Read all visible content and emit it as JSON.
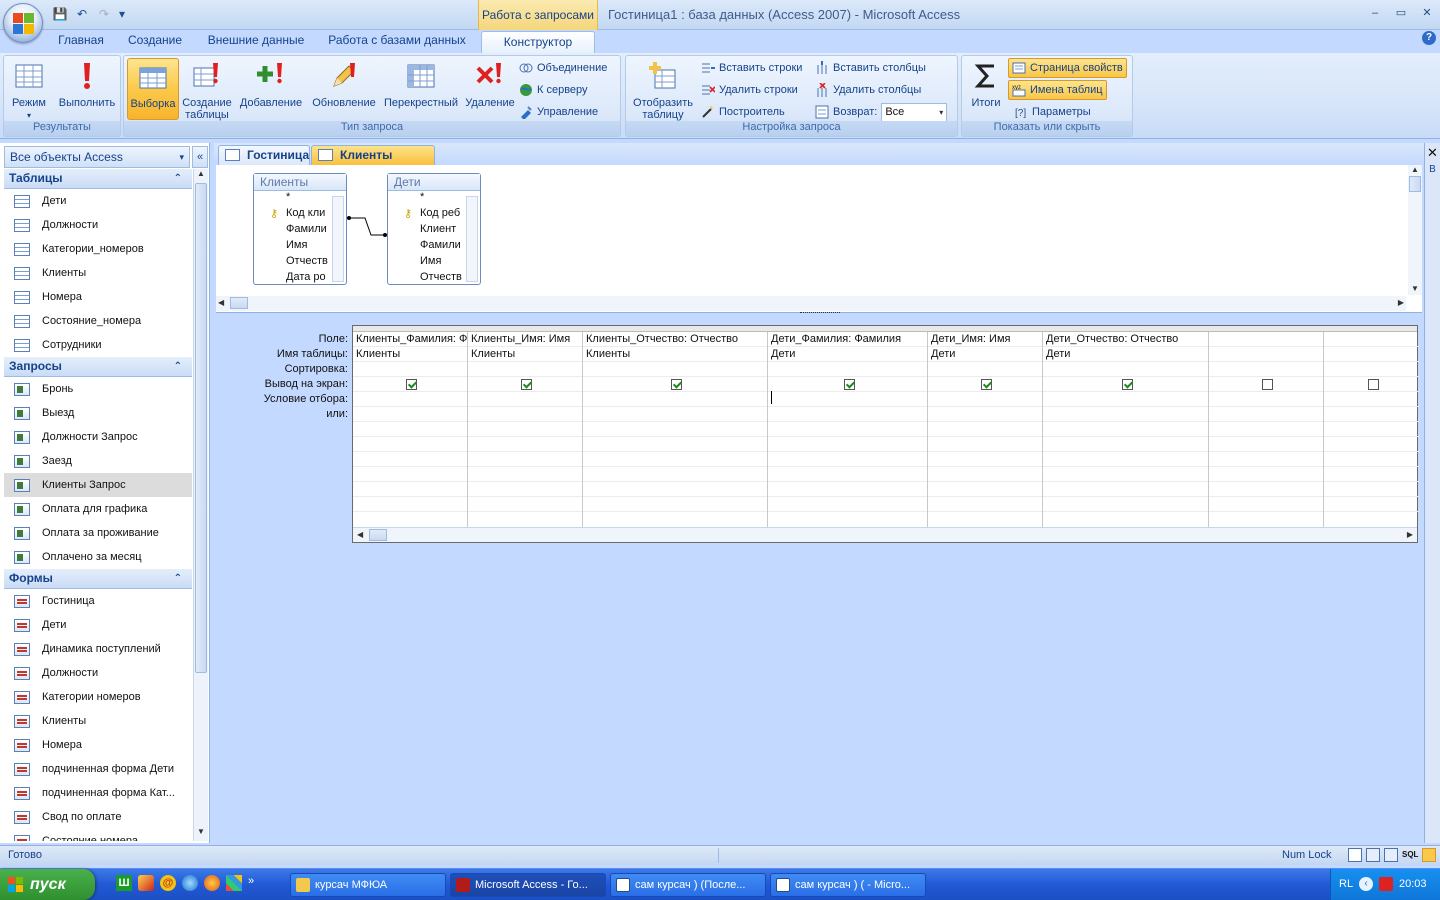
{
  "titlebar": {
    "context_tab": "Работа с запросами",
    "window_title": "Гостиница1 : база данных (Access 2007) - Microsoft Access",
    "minimize": "‒",
    "restore": "▭",
    "close": "✕"
  },
  "qat": {
    "save": "💾",
    "undo": "↶",
    "redo": "↷",
    "customize": "▾"
  },
  "tabs": [
    "Главная",
    "Создание",
    "Внешние данные",
    "Работа с базами данных",
    "Конструктор"
  ],
  "help": "?",
  "ribbon": {
    "results": {
      "label": "Результаты",
      "mode": "Режим",
      "run": "Выполнить"
    },
    "query_type": {
      "label": "Тип запроса",
      "select": "Выборка",
      "make_table": "Создание таблицы",
      "append": "Добавление",
      "update": "Обновление",
      "crosstab": "Перекрестный",
      "delete": "Удаление",
      "union": "Объединение",
      "pass_through": "К серверу",
      "data_def": "Управление"
    },
    "query_setup": {
      "label": "Настройка запроса",
      "show_table": "Отобразить таблицу",
      "insert_rows": "Вставить строки",
      "delete_rows": "Удалить строки",
      "builder": "Построитель",
      "insert_cols": "Вставить столбцы",
      "delete_cols": "Удалить столбцы",
      "return_label": "Возврат:",
      "return_value": "Все"
    },
    "show_hide": {
      "label": "Показать или скрыть",
      "totals": "Итоги",
      "property_sheet": "Страница свойств",
      "table_names": "Имена таблиц",
      "parameters": "Параметры"
    }
  },
  "nav": {
    "header": "Все объекты Access",
    "collapse": "«",
    "sections": [
      {
        "title": "Таблицы",
        "type": "tbl",
        "items": [
          "Дети",
          "Должности",
          "Категории_номеров",
          "Клиенты",
          "Номера",
          "Состояние_номера",
          "Сотрудники"
        ]
      },
      {
        "title": "Запросы",
        "type": "qry",
        "items": [
          "Бронь",
          "Выезд",
          "Должности Запрос",
          "Заезд",
          "Клиенты Запрос",
          "Оплата для графика",
          "Оплата за проживание",
          "Оплачено за месяц"
        ]
      },
      {
        "title": "Формы",
        "type": "frm",
        "items": [
          "Гостиница",
          "Дети",
          "Динамика поступлений",
          "Должности",
          "Категории номеров",
          "Клиенты",
          "Номера",
          "подчиненная форма Дети",
          "подчиненная форма Кат...",
          "Свод по оплате",
          "Состояние номера"
        ]
      }
    ],
    "selected": "Клиенты Запрос"
  },
  "doc_tabs": [
    "Гостиница",
    "Клиенты Запрос"
  ],
  "doc_close": "✕",
  "tables": [
    {
      "name": "Клиенты",
      "fields": [
        "*",
        "Код кли",
        "Фамили",
        "Имя",
        "Отчеств",
        "Дата ро"
      ]
    },
    {
      "name": "Дети",
      "fields": [
        "*",
        "Код реб",
        "Клиент",
        "Фамили",
        "Имя",
        "Отчеств"
      ]
    }
  ],
  "grid": {
    "row_labels": [
      "Поле:",
      "Имя таблицы:",
      "Сортировка:",
      "Вывод на экран:",
      "Условие отбора:",
      "или:"
    ],
    "columns": [
      {
        "field": "Клиенты_Фамилия: Фамилия",
        "table": "Клиенты",
        "show": true
      },
      {
        "field": "Клиенты_Имя: Имя",
        "table": "Клиенты",
        "show": true
      },
      {
        "field": "Клиенты_Отчество: Отчество",
        "table": "Клиенты",
        "show": true
      },
      {
        "field": "Дети_Фамилия: Фамилия",
        "table": "Дети",
        "show": true
      },
      {
        "field": "Дети_Имя: Имя",
        "table": "Дети",
        "show": true
      },
      {
        "field": "Дети_Отчество: Отчество",
        "table": "Дети",
        "show": true
      },
      {
        "field": "",
        "table": "",
        "show": false
      },
      {
        "field": "",
        "table": "",
        "show": false
      }
    ]
  },
  "status": {
    "left": "Готово",
    "numlock": "Num Lock"
  },
  "props_letter": "В",
  "taskbar": {
    "start": "пуск",
    "buttons": [
      "курсач МФЮА",
      "Microsoft Access - Го...",
      "сам курсач ) (После...",
      "сам курсач ) ( - Micro..."
    ],
    "lang": "RL",
    "clock": "20:03"
  }
}
